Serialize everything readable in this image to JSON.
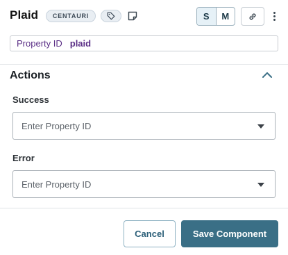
{
  "header": {
    "title": "Plaid",
    "badge": "CENTAURI",
    "size_small": "S",
    "size_medium": "M"
  },
  "property": {
    "label": "Property ID",
    "value": "plaid"
  },
  "actions": {
    "title": "Actions",
    "success": {
      "label": "Success",
      "placeholder": "Enter Property ID"
    },
    "error": {
      "label": "Error",
      "placeholder": "Enter Property ID"
    }
  },
  "footer": {
    "cancel_label": "Cancel",
    "save_label": "Save Component"
  },
  "icons": {
    "tag": "tag-icon",
    "note": "note-icon",
    "link": "link-icon",
    "more": "more-vertical-icon",
    "collapse": "chevron-up-icon",
    "dropdown": "caret-down-icon"
  },
  "colors": {
    "accent": "#3a6f86",
    "property_text": "#5b2f86"
  }
}
